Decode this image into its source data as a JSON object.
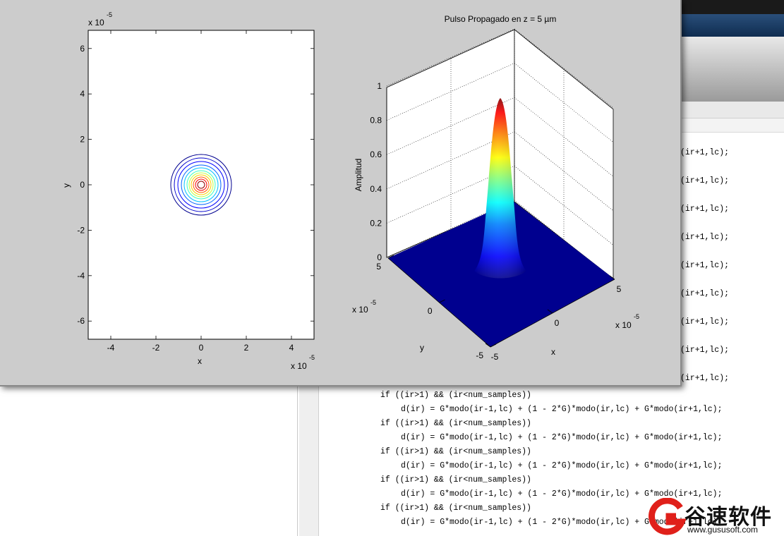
{
  "contour_plot": {
    "xlabel": "x",
    "ylabel": "y",
    "x_ticks": [
      "-4",
      "-2",
      "0",
      "2",
      "4"
    ],
    "y_ticks": [
      "6",
      "4",
      "2",
      "0",
      "-2",
      "-4",
      "-6"
    ],
    "x_exponent_base": "x 10",
    "x_exponent_power": "-5",
    "y_exponent_base": "x 10",
    "y_exponent_power": "-5"
  },
  "surface_plot": {
    "title": "Pulso Propagado en z =   5 µm",
    "zlabel": "Amplitud",
    "xlabel": "x",
    "ylabel": "y",
    "z_ticks": [
      "1",
      "0.8",
      "0.6",
      "0.4",
      "0.2",
      "0"
    ],
    "x_ticks": [
      "-5",
      "0",
      "5"
    ],
    "y_ticks": [
      "5",
      "0",
      "-5"
    ],
    "x_exponent_base": "x 10",
    "x_exponent_power": "-5",
    "y_exponent_base": "x 10",
    "y_exponent_power": "-5"
  },
  "chart_data": [
    {
      "type": "contour",
      "xlabel": "x",
      "ylabel": "y",
      "xlim": [
        -5e-05,
        5e-05
      ],
      "ylim": [
        -6.8e-05,
        6.8e-05
      ],
      "center": [
        0,
        0
      ],
      "colormap": "jet",
      "levels": 10
    },
    {
      "type": "surface",
      "title": "Pulso Propagado en z =   5 µm",
      "xlabel": "x",
      "ylabel": "y",
      "zlabel": "Amplitud",
      "xlim": [
        -5e-05,
        5e-05
      ],
      "ylim": [
        -5e-05,
        5e-05
      ],
      "zlim": [
        0,
        1
      ],
      "peak": 0.94,
      "colormap": "jet"
    }
  ],
  "code_lines": [
    {
      "indent": "",
      "text": "(ir+1,lc);"
    },
    {
      "indent": "",
      "text": "(ir+1,lc);"
    },
    {
      "indent": "",
      "text": "(ir+1,lc);"
    },
    {
      "indent": "",
      "text": "(ir+1,lc);"
    },
    {
      "indent": "",
      "text": "(ir+1,lc);"
    },
    {
      "indent": "",
      "text": "(ir+1,lc);"
    },
    {
      "indent": "",
      "text": "(ir+1,lc);"
    },
    {
      "indent": "",
      "text": "(ir+1,lc);"
    },
    {
      "indent": "",
      "text": "(ir+1,lc);"
    },
    {
      "indent": "",
      "text": "if ((ir>1) && (ir<num_samples))"
    },
    {
      "indent": "    ",
      "text": "d(ir) = G*modo(ir-1,lc) + (1 - 2*G)*modo(ir,lc) + G*modo(ir+1,lc);"
    },
    {
      "indent": "",
      "text": "if ((ir>1) && (ir<num_samples))"
    },
    {
      "indent": "    ",
      "text": "d(ir) = G*modo(ir-1,lc) + (1 - 2*G)*modo(ir,lc) + G*modo(ir+1,lc);"
    },
    {
      "indent": "",
      "text": "if ((ir>1) && (ir<num_samples))"
    },
    {
      "indent": "    ",
      "text": "d(ir) = G*modo(ir-1,lc) + (1 - 2*G)*modo(ir,lc) + G*modo(ir+1,lc);"
    },
    {
      "indent": "",
      "text": "if ((ir>1) && (ir<num_samples))"
    },
    {
      "indent": "    ",
      "text": "d(ir) = G*modo(ir-1,lc) + (1 - 2*G)*modo(ir,lc) + G*modo(ir+1,lc);"
    },
    {
      "indent": "",
      "text": "if ((ir>1) && (ir<num_samples))"
    },
    {
      "indent": "    ",
      "text": "d(ir) = G*modo(ir-1,lc) + (1 - 2*G)*modo(ir,lc) + G*modo(ir+1,lc);"
    }
  ],
  "watermark": {
    "name": "谷速软件",
    "url": "www.gususoft.com"
  },
  "colors": {
    "figure_bg": "#cccccc",
    "axes_bg": "#ffffff",
    "surface_base": "#00008f"
  }
}
